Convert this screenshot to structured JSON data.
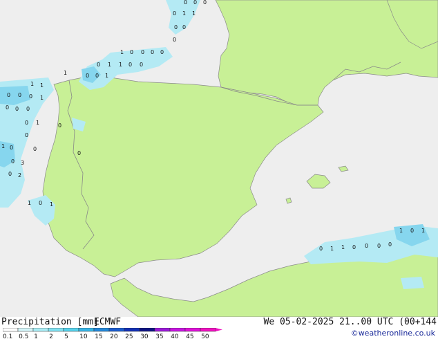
{
  "footer": {
    "title": "Precipitation [mm]",
    "model": "ECMWF",
    "datetime": "We 05-02-2025 21..00 UTC (00+144",
    "credit": "©weatheronline.co.uk"
  },
  "legend": {
    "labels": [
      "0.1",
      "0.5",
      "1",
      "2",
      "5",
      "10",
      "15",
      "20",
      "25",
      "30",
      "35",
      "40",
      "45",
      "50"
    ],
    "colors": [
      "#ffffff",
      "#d4f6fa",
      "#aaeef6",
      "#7fe2f2",
      "#55d2ec",
      "#36b4e6",
      "#2288da",
      "#1a5ccf",
      "#1230b4",
      "#0c1282",
      "#9a18d8",
      "#c614e0",
      "#de10d8",
      "#f010c0"
    ]
  },
  "colors": {
    "sea": "#eeeeee",
    "land": "#c8f096",
    "border": "#888888",
    "coast": "#8a8a8a",
    "precip_light": "#b4eaf4",
    "precip_medium": "#86d6ee",
    "value_text": "#111111"
  },
  "precip_values": [
    "0",
    "0",
    "0",
    "0",
    "1",
    "1",
    "0",
    "0",
    "0",
    "1",
    "0",
    "0",
    "0",
    "0",
    "0",
    "1",
    "1",
    "0",
    "0",
    "1",
    "0",
    "0",
    "1",
    "1",
    "1",
    "0",
    "0",
    "0",
    "1",
    "0",
    "0",
    "0",
    "0",
    "1",
    "0",
    "0",
    "1",
    "0",
    "0",
    "0",
    "0",
    "3",
    "0",
    "2",
    "1",
    "0",
    "1",
    "1",
    "0",
    "1",
    "0",
    "1",
    "1",
    "0",
    "0",
    "0",
    "0"
  ]
}
